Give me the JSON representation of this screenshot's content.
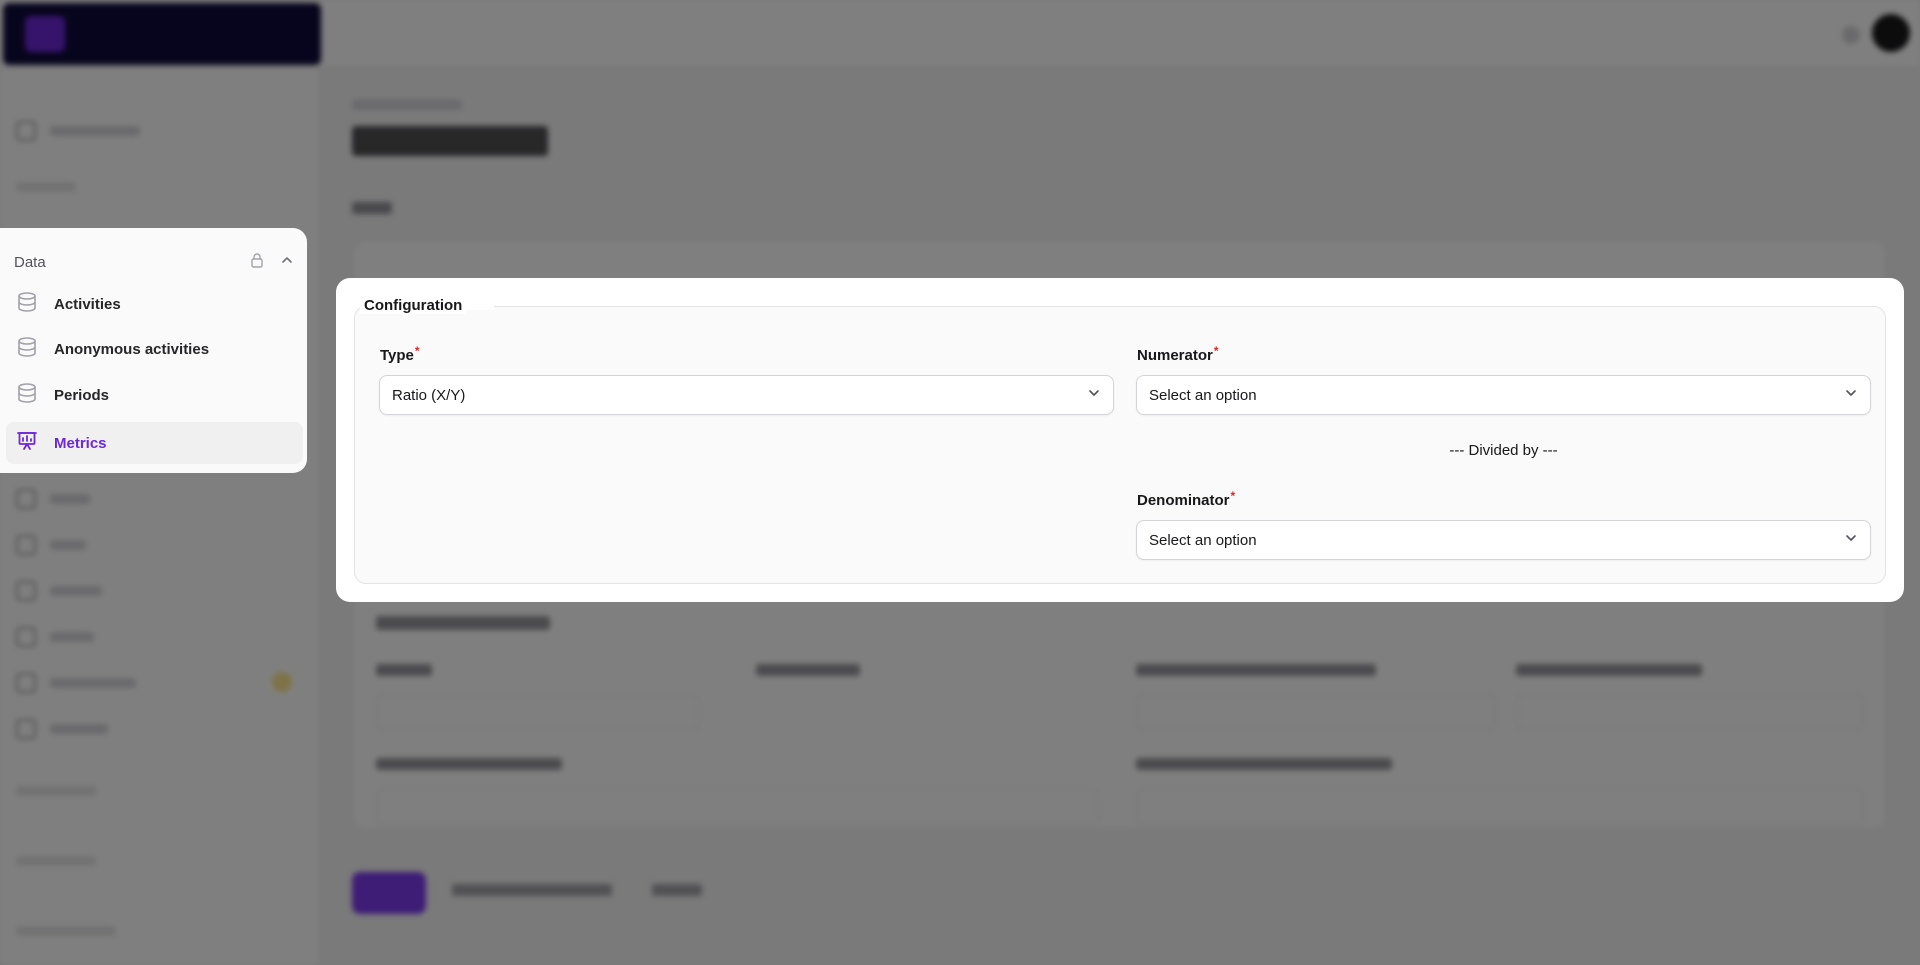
{
  "sidebar_card": {
    "group_label": "Data",
    "items": [
      {
        "label": "Activities",
        "icon": "database-icon",
        "active": false
      },
      {
        "label": "Anonymous activities",
        "icon": "database-icon",
        "active": false
      },
      {
        "label": "Periods",
        "icon": "database-icon",
        "active": false
      },
      {
        "label": "Metrics",
        "icon": "presentation-chart-icon",
        "active": true
      }
    ]
  },
  "configuration": {
    "legend": "Configuration",
    "type": {
      "label": "Type",
      "required_mark": "*",
      "value": "Ratio (X/Y)"
    },
    "numerator": {
      "label": "Numerator",
      "required_mark": "*",
      "value": "Select an option"
    },
    "divider_text": "--- Divided by ---",
    "denominator": {
      "label": "Denominator",
      "required_mark": "*",
      "value": "Select an option"
    }
  },
  "colors": {
    "accent": "#6d28d9",
    "required": "#dc2626",
    "overlay": "rgba(0,0,0,0.5)"
  }
}
